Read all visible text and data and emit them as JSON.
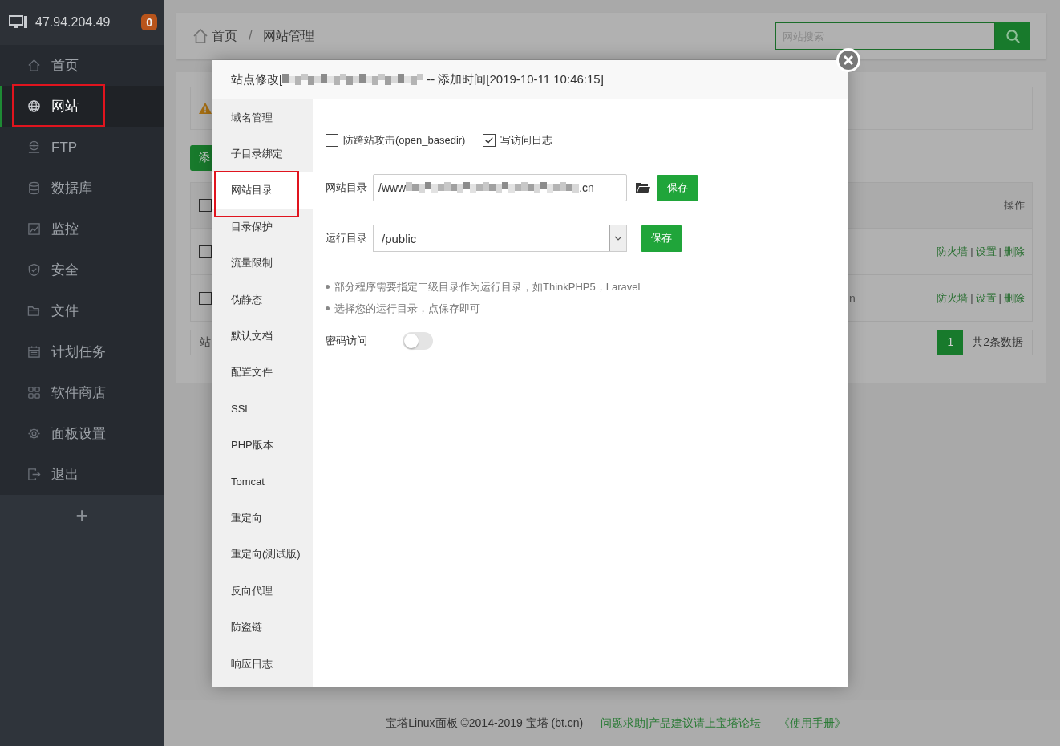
{
  "sidebar": {
    "host": "47.94.204.49",
    "badge": "0",
    "items": [
      {
        "label": "首页",
        "selected": false,
        "highlighted": false
      },
      {
        "label": "网站",
        "selected": true,
        "highlighted": true
      },
      {
        "label": "FTP",
        "selected": false,
        "highlighted": false
      },
      {
        "label": "数据库",
        "selected": false,
        "highlighted": false
      },
      {
        "label": "监控",
        "selected": false,
        "highlighted": false
      },
      {
        "label": "安全",
        "selected": false,
        "highlighted": false
      },
      {
        "label": "文件",
        "selected": false,
        "highlighted": false
      },
      {
        "label": "计划任务",
        "selected": false,
        "highlighted": false
      },
      {
        "label": "软件商店",
        "selected": false,
        "highlighted": false
      },
      {
        "label": "面板设置",
        "selected": false,
        "highlighted": false
      },
      {
        "label": "退出",
        "selected": false,
        "highlighted": false
      }
    ],
    "add_label": "+"
  },
  "header": {
    "breadcrumb": [
      "首页",
      "网站管理"
    ],
    "separator": "/",
    "search": {
      "placeholder": "网站搜索"
    }
  },
  "background": {
    "add_button": "添",
    "table": {
      "select_all": {
        "checked": false
      },
      "action_header": "操作",
      "separator": "|",
      "rows": [
        {
          "checked": false,
          "actions": [
            "防火墙",
            "设置",
            "删除"
          ]
        },
        {
          "checked": false,
          "cell_3": "n",
          "actions": [
            "防火墙",
            "设置",
            "删除"
          ]
        }
      ]
    },
    "footer_label": "站",
    "pagination": {
      "page": "1",
      "total": "共2条数据"
    }
  },
  "modal": {
    "title_prefix": "站点修改[",
    "title_suffix": "-- 添加时间[2019-10-11 10:46:15]",
    "nav": [
      {
        "label": "域名管理",
        "selected": false,
        "highlighted": false
      },
      {
        "label": "子目录绑定",
        "selected": false,
        "highlighted": false
      },
      {
        "label": "网站目录",
        "selected": true,
        "highlighted": true
      },
      {
        "label": "目录保护",
        "selected": false,
        "highlighted": false
      },
      {
        "label": "流量限制",
        "selected": false,
        "highlighted": false
      },
      {
        "label": "伪静态",
        "selected": false,
        "highlighted": false
      },
      {
        "label": "默认文档",
        "selected": false,
        "highlighted": false
      },
      {
        "label": "配置文件",
        "selected": false,
        "highlighted": false
      },
      {
        "label": "SSL",
        "selected": false,
        "highlighted": false
      },
      {
        "label": "PHP版本",
        "selected": false,
        "highlighted": false
      },
      {
        "label": "Tomcat",
        "selected": false,
        "highlighted": false
      },
      {
        "label": "重定向",
        "selected": false,
        "highlighted": false
      },
      {
        "label": "重定向(测试版)",
        "selected": false,
        "highlighted": false
      },
      {
        "label": "反向代理",
        "selected": false,
        "highlighted": false
      },
      {
        "label": "防盗链",
        "selected": false,
        "highlighted": false
      },
      {
        "label": "响应日志",
        "selected": false,
        "highlighted": false
      }
    ],
    "options": [
      {
        "label": "防跨站攻击(open_basedir)",
        "checked": false
      },
      {
        "label": "写访问日志",
        "checked": true
      }
    ],
    "site_dir": {
      "label": "网站目录",
      "value_start": "/www",
      "value_end": ".cn",
      "button": "保存"
    },
    "run_dir": {
      "label": "运行目录",
      "value": "/public",
      "button": "保存"
    },
    "notes": [
      "部分程序需要指定二级目录作为运行目录，如ThinkPHP5，Laravel",
      "选择您的运行目录，点保存即可"
    ],
    "password_access": {
      "label": "密码访问",
      "on": false
    }
  },
  "footer": {
    "copyright": "宝塔Linux面板 ©2014-2019 宝塔 (bt.cn)",
    "links": [
      "问题求助|产品建议请上宝塔论坛",
      "《使用手册》"
    ]
  }
}
